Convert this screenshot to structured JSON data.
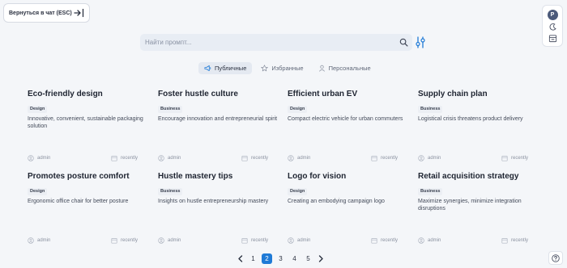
{
  "header": {
    "back_label": "Вернуться в чат (ESC)"
  },
  "side_panel": {
    "avatar_letter": "P"
  },
  "search": {
    "placeholder": "Найти промпт..."
  },
  "tabs": [
    {
      "label": "Публичные",
      "active": true
    },
    {
      "label": "Избранные",
      "active": false
    },
    {
      "label": "Персональные",
      "active": false
    }
  ],
  "cards": [
    {
      "title": "Eco-friendly design",
      "tag": "Design",
      "desc": "Innovative, convenient, sustainable packaging solution",
      "author": "admin",
      "date": "recently"
    },
    {
      "title": "Foster hustle culture",
      "tag": "Business",
      "desc": "Encourage innovation and entrepreneurial spirit",
      "author": "admin",
      "date": "recently"
    },
    {
      "title": "Efficient urban EV",
      "tag": "Design",
      "desc": "Compact electric vehicle for urban commuters",
      "author": "admin",
      "date": "recently"
    },
    {
      "title": "Supply chain plan",
      "tag": "Business",
      "desc": "Logistical crisis threatens product delivery",
      "author": "admin",
      "date": "recently"
    },
    {
      "title": "Promotes posture comfort",
      "tag": "Design",
      "desc": "Ergonomic office chair for better posture",
      "author": "admin",
      "date": "recently"
    },
    {
      "title": "Hustle mastery tips",
      "tag": "Business",
      "desc": "Insights on hustle entrepreneurship mastery",
      "author": "admin",
      "date": "recently"
    },
    {
      "title": "Logo for vision",
      "tag": "Design",
      "desc": "Creating an embodying campaign logo",
      "author": "admin",
      "date": "recently"
    },
    {
      "title": "Retail acquisition strategy",
      "tag": "Business",
      "desc": "Maximize synergies, minimize integration disruptions",
      "author": "admin",
      "date": "recently"
    }
  ],
  "pagination": {
    "pages": [
      "1",
      "2",
      "3",
      "4",
      "5"
    ],
    "current": "2"
  },
  "colors": {
    "accent": "#1f7ad6",
    "background": "#f4f6f9",
    "tag_bg": "#eceff4"
  },
  "icons": {
    "back": "arrow-right-bar-icon",
    "search": "search-icon",
    "filter": "sliders-icon",
    "public_tab": "megaphone-icon",
    "favorites_tab": "star-icon",
    "personal_tab": "user-icon",
    "author": "user-circle-icon",
    "date": "calendar-icon",
    "theme": "moon-icon",
    "library": "library-icon",
    "help": "question-icon"
  }
}
